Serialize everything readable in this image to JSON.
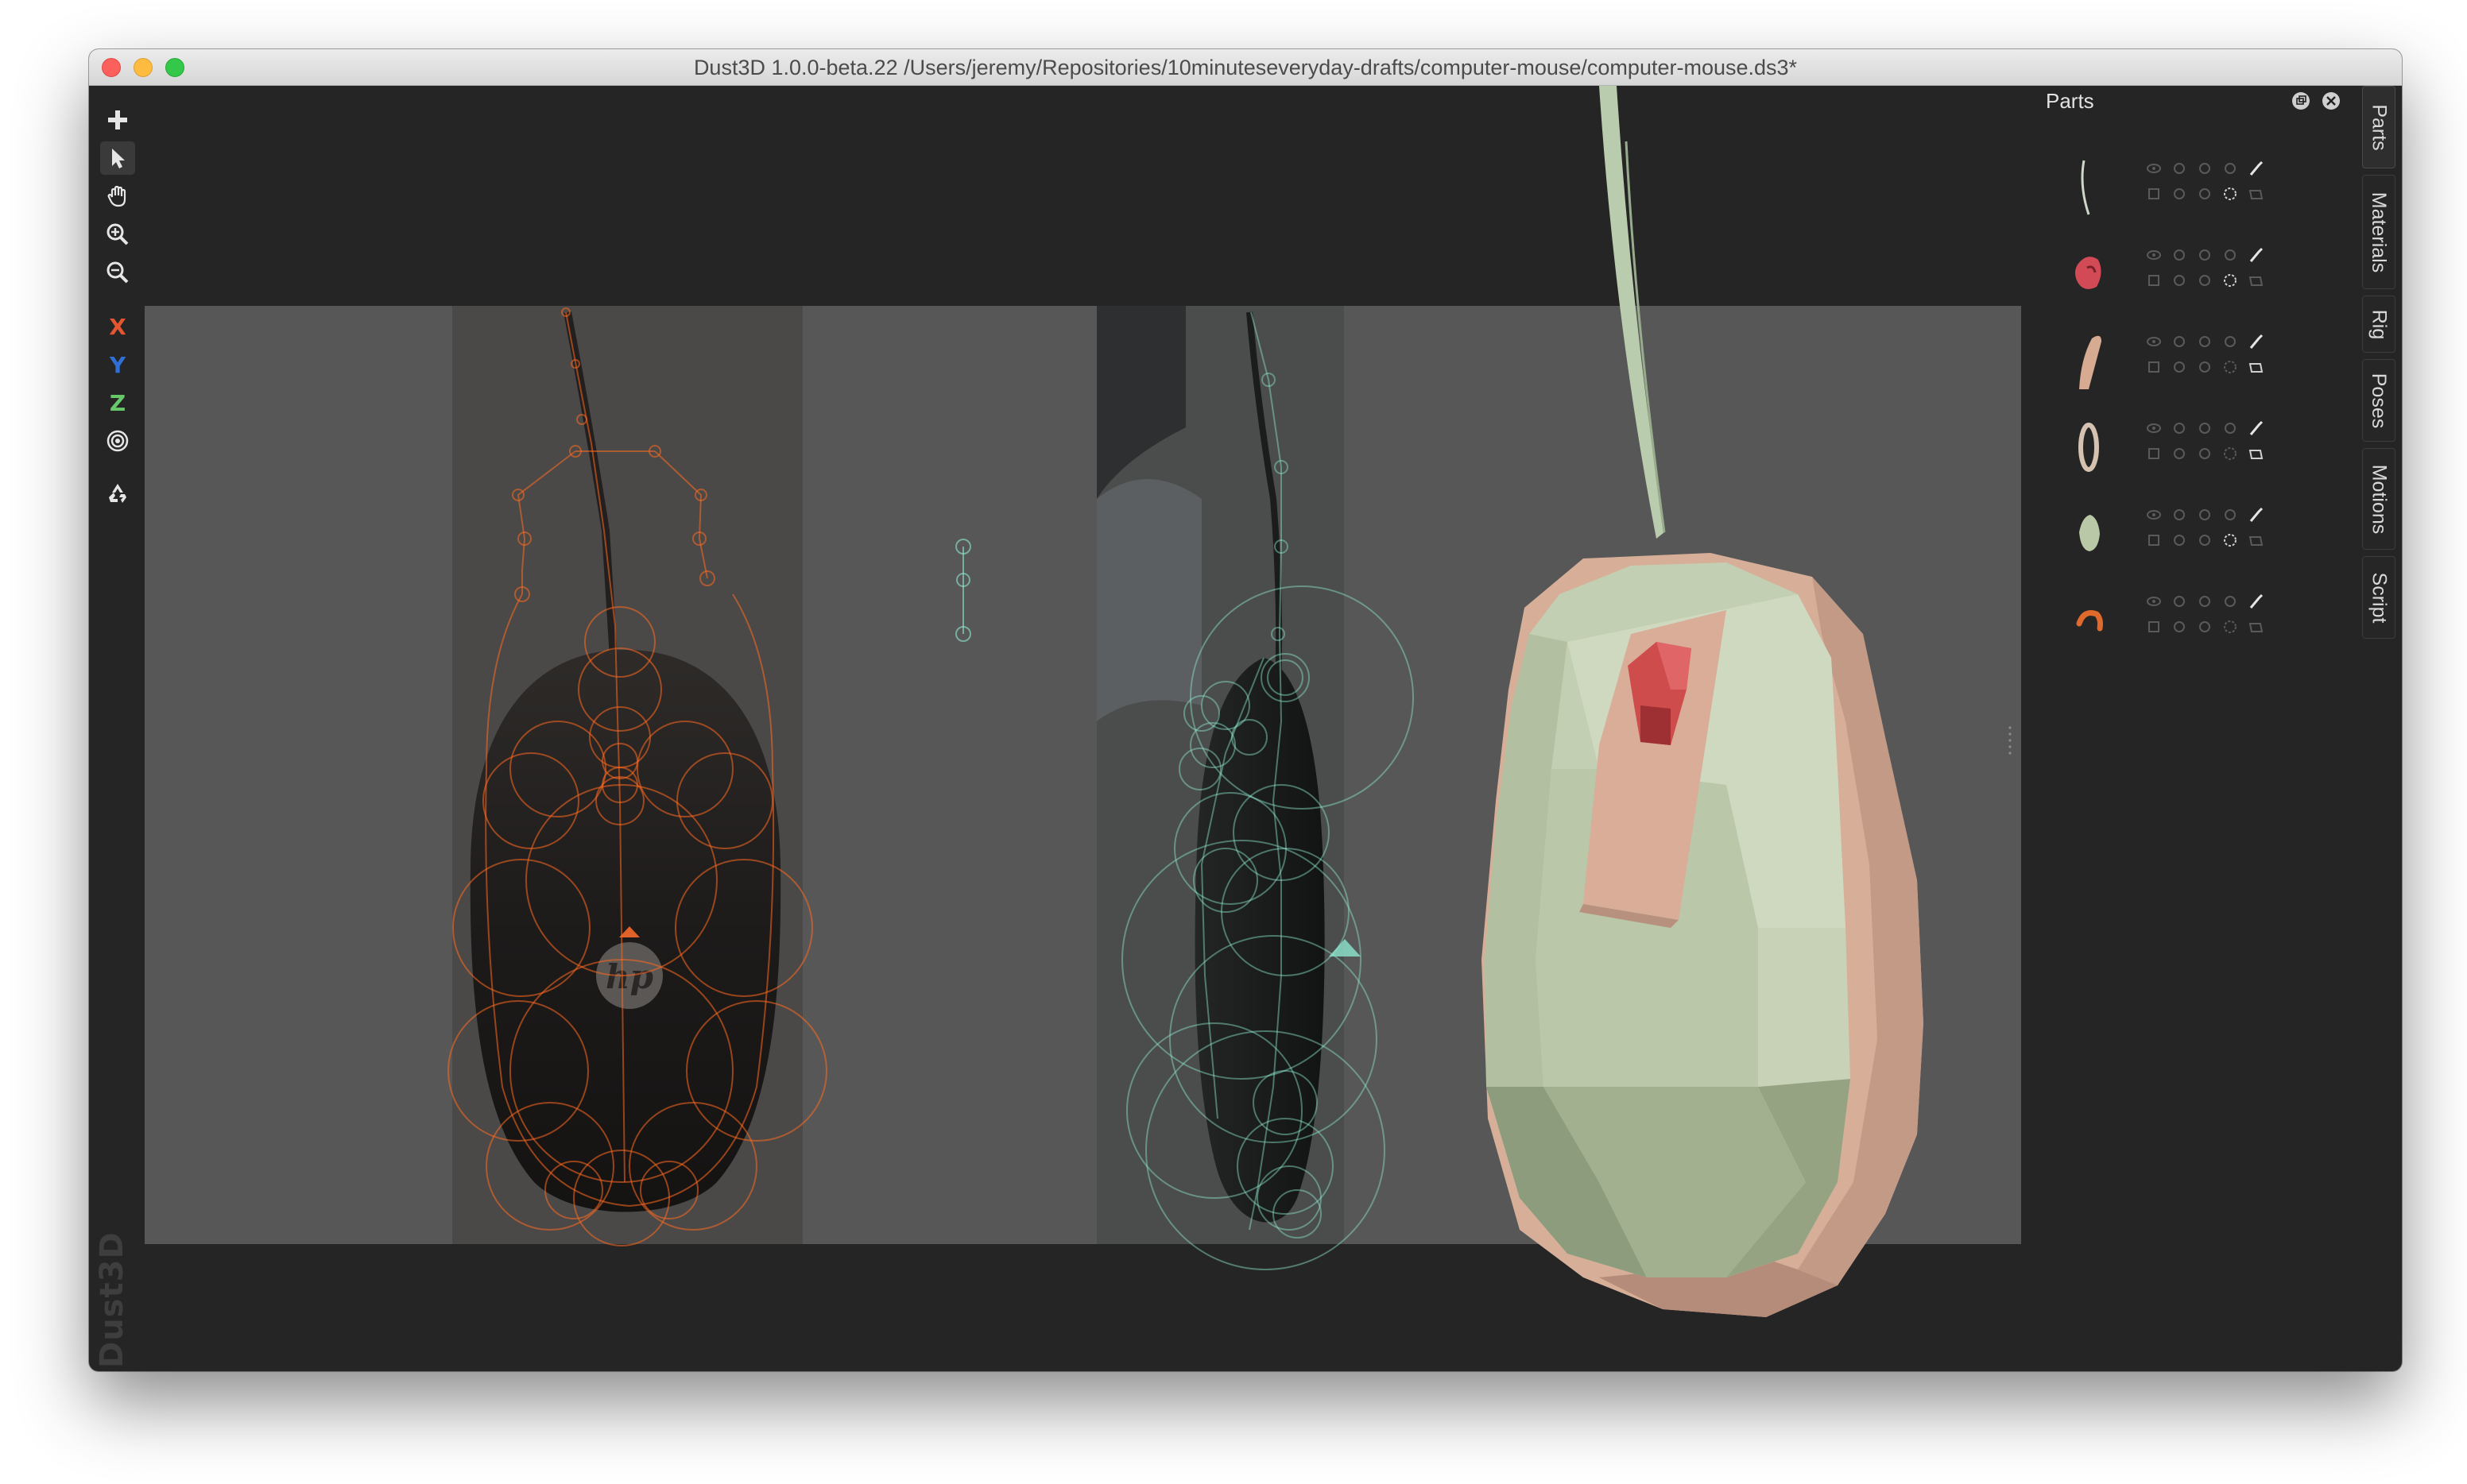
{
  "window": {
    "title": "Dust3D 1.0.0-beta.22 /Users/jeremy/Repositories/10minuteseveryday-drafts/computer-mouse/computer-mouse.ds3*"
  },
  "toolbar": {
    "tools": [
      {
        "name": "add-node",
        "icon": "plus-icon"
      },
      {
        "name": "select",
        "icon": "arrow-cursor-icon"
      },
      {
        "name": "pan",
        "icon": "hand-icon"
      },
      {
        "name": "zoom-in",
        "icon": "zoom-in-icon"
      },
      {
        "name": "zoom-out",
        "icon": "zoom-out-icon"
      }
    ],
    "axes": {
      "x": "X",
      "y": "Y",
      "z": "Z"
    },
    "radial_icon": "radial-icon",
    "regenerate_icon": "recycle-icon"
  },
  "watermark": "Dust3D",
  "parts_panel": {
    "title": "Parts",
    "restore_icon": "restore-icon",
    "close_icon": "close-icon",
    "parts": [
      {
        "thumb": "cable",
        "color": "#cfd8c8"
      },
      {
        "thumb": "wheel",
        "color": "#d14a56"
      },
      {
        "thumb": "side",
        "color": "#d7aa92"
      },
      {
        "thumb": "ring",
        "color": "#d6c2b0"
      },
      {
        "thumb": "shell",
        "color": "#b9c9a7"
      },
      {
        "thumb": "hook",
        "color": "#e06a2c"
      }
    ]
  },
  "side_tabs": [
    "Parts",
    "Materials",
    "Rig",
    "Poses",
    "Motions",
    "Script"
  ],
  "colors": {
    "front_profile": "#ff6a20",
    "side_profile": "#8ee6cf",
    "mouse_body": "#c3cfb2",
    "mouse_trim": "#d8b09c",
    "mouse_wheel": "#cf4c4c",
    "cable": "#b4c9ab"
  },
  "logo_text": "hp"
}
